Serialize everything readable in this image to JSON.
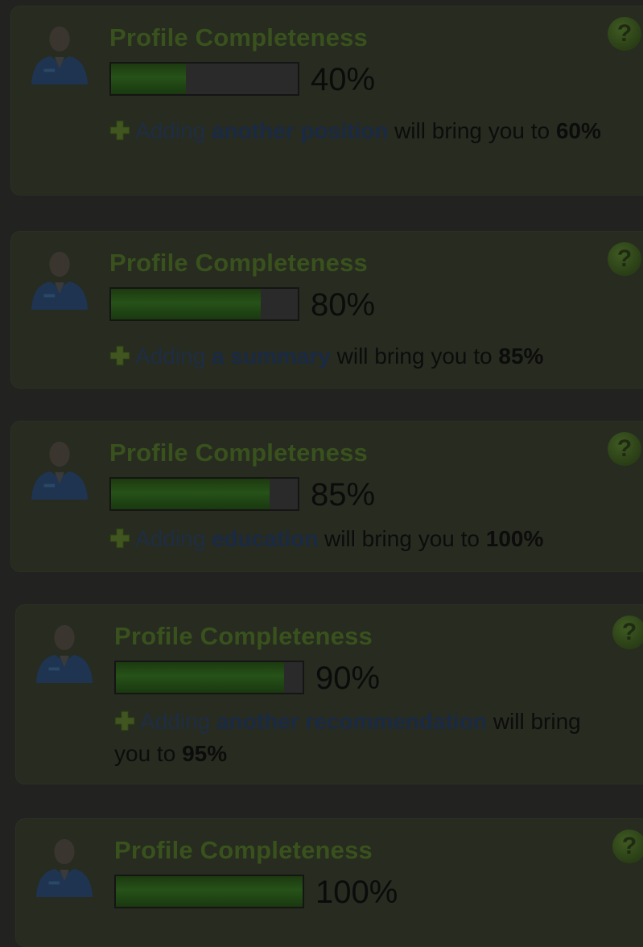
{
  "cards": [
    {
      "title": "Profile Completeness",
      "progress_percent": 40,
      "percent_label": "40%",
      "tip_prefix": "Adding",
      "tip_link": "another position",
      "tip_middle": "will bring you to",
      "tip_target": "60%"
    },
    {
      "title": "Profile Completeness",
      "progress_percent": 80,
      "percent_label": "80%",
      "tip_prefix": "Adding",
      "tip_link": "a summary",
      "tip_middle": "will bring you to",
      "tip_target": "85%"
    },
    {
      "title": "Profile Completeness",
      "progress_percent": 85,
      "percent_label": "85%",
      "tip_prefix": "Adding",
      "tip_link": "education",
      "tip_middle": "will bring you to",
      "tip_target": "100%"
    },
    {
      "title": "Profile Completeness",
      "progress_percent": 90,
      "percent_label": "90%",
      "tip_prefix": "Adding",
      "tip_link": "another recommendation",
      "tip_middle": "will bring you to",
      "tip_target": "95%"
    },
    {
      "title": "Profile Completeness",
      "progress_percent": 100,
      "percent_label": "100%"
    }
  ],
  "icons": {
    "help": "question-mark-icon",
    "add": "plus-icon",
    "avatar": "user-silhouette-icon"
  },
  "colors": {
    "progress_fill": "#265218",
    "title_green": "#39521d",
    "link_blue": "#1a2a44",
    "overlay_background": "#222320"
  }
}
